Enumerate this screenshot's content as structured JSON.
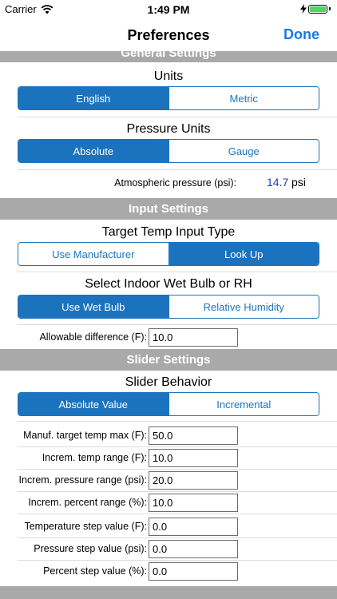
{
  "status_bar": {
    "carrier": "Carrier",
    "time": "1:49 PM"
  },
  "nav": {
    "title": "Preferences",
    "done_label": "Done"
  },
  "sections": {
    "general": "General Settings",
    "input": "Input Settings",
    "slider": "Slider Settings"
  },
  "units": {
    "label": "Units",
    "options": [
      "English",
      "Metric"
    ],
    "selected": "English"
  },
  "pressure_units": {
    "label": "Pressure Units",
    "options": [
      "Absolute",
      "Gauge"
    ],
    "selected": "Absolute"
  },
  "atmospheric": {
    "label": "Atmospheric pressure (psi):",
    "value": "14.7",
    "unit": "psi"
  },
  "target_temp": {
    "label": "Target Temp Input Type",
    "options": [
      "Use Manufacturer",
      "Look Up"
    ],
    "selected": "Look Up"
  },
  "wet_bulb": {
    "label": "Select Indoor Wet Bulb or RH",
    "options": [
      "Use Wet Bulb",
      "Relative Humidity"
    ],
    "selected": "Use Wet Bulb"
  },
  "allowable": {
    "label": "Allowable difference (F):",
    "value": "10.0"
  },
  "slider_behavior": {
    "label": "Slider Behavior",
    "options": [
      "Absolute Value",
      "Incremental"
    ],
    "selected": "Absolute Value"
  },
  "slider_fields": [
    {
      "label": "Manuf. target temp max (F):",
      "value": "50.0"
    },
    {
      "label": "Increm. temp range (F):",
      "value": "10.0"
    },
    {
      "label": "Increm. pressure range (psi):",
      "value": "20.0"
    },
    {
      "label": "Increm. percent range (%):",
      "value": "10.0"
    },
    {
      "label": "Temperature step value (F):",
      "value": "0.0"
    },
    {
      "label": "Pressure step value (psi):",
      "value": "0.0"
    },
    {
      "label": "Percent step value (%):",
      "value": "0.0"
    }
  ],
  "colors": {
    "accent": "#1c73bd",
    "done": "#1a7ae0",
    "header_bg": "#a9a9a9",
    "value_blue": "#2040b0"
  }
}
